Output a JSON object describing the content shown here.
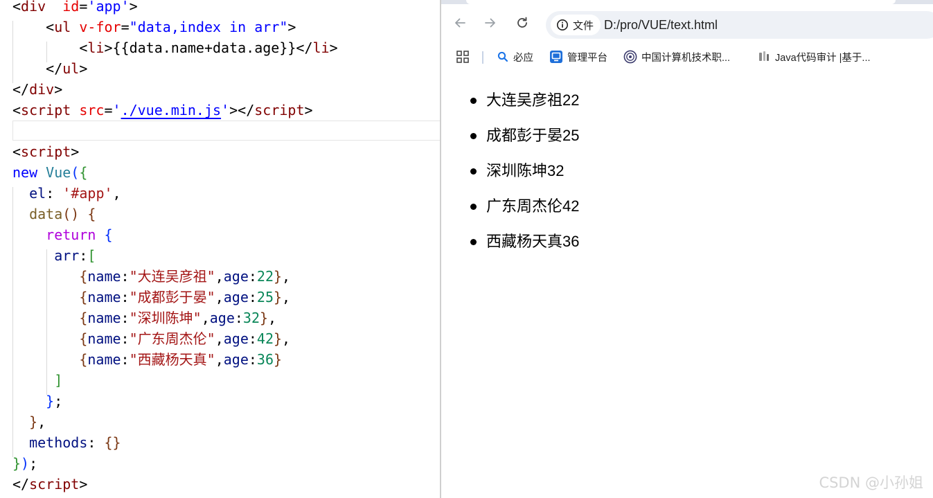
{
  "editor": {
    "lines": [
      [
        [
          "t-plain",
          "<"
        ],
        [
          "t-tag",
          "div"
        ],
        [
          "t-plain",
          "  "
        ],
        [
          "t-attr",
          "id"
        ],
        [
          "t-plain",
          "="
        ],
        [
          "t-str",
          "'app'"
        ],
        [
          "t-plain",
          ">"
        ]
      ],
      [
        [
          "t-plain",
          "    <"
        ],
        [
          "t-tag",
          "ul"
        ],
        [
          "t-plain",
          " "
        ],
        [
          "t-attr",
          "v-for"
        ],
        [
          "t-plain",
          "="
        ],
        [
          "t-str",
          "\"data,index in arr\""
        ],
        [
          "t-plain",
          ">"
        ]
      ],
      [
        [
          "t-plain",
          "        <"
        ],
        [
          "t-tag",
          "li"
        ],
        [
          "t-plain",
          ">{{data.name+data.age}}</"
        ],
        [
          "t-tag",
          "li"
        ],
        [
          "t-plain",
          ">"
        ]
      ],
      [
        [
          "t-plain",
          "    </"
        ],
        [
          "t-tag",
          "ul"
        ],
        [
          "t-plain",
          ">"
        ]
      ],
      [
        [
          "t-plain",
          "</"
        ],
        [
          "t-tag",
          "div"
        ],
        [
          "t-plain",
          ">"
        ]
      ],
      [
        [
          "t-plain",
          "<"
        ],
        [
          "t-tag",
          "script"
        ],
        [
          "t-plain",
          " "
        ],
        [
          "t-attr",
          "src"
        ],
        [
          "t-plain",
          "="
        ],
        [
          "t-str",
          "'"
        ],
        [
          "t-link",
          "./vue.min.js"
        ],
        [
          "t-str",
          "'"
        ],
        [
          "t-plain",
          "></"
        ],
        [
          "t-tag",
          "script"
        ],
        [
          "t-plain",
          ">"
        ]
      ],
      [
        [
          "t-plain",
          ""
        ]
      ],
      [
        [
          "t-plain",
          "<"
        ],
        [
          "t-tag",
          "script"
        ],
        [
          "t-plain",
          ">"
        ]
      ],
      [
        [
          "t-kw",
          "new"
        ],
        [
          "t-plain",
          " "
        ],
        [
          "t-cls",
          "Vue"
        ],
        [
          "t-b1",
          "("
        ],
        [
          "t-b2",
          "{"
        ]
      ],
      [
        [
          "t-plain",
          "  "
        ],
        [
          "t-prop",
          "el"
        ],
        [
          "t-plain",
          ": "
        ],
        [
          "t-sval",
          "'#app'"
        ],
        [
          "t-plain",
          ","
        ]
      ],
      [
        [
          "t-plain",
          "  "
        ],
        [
          "t-fn",
          "data"
        ],
        [
          "t-b3",
          "()"
        ],
        [
          "t-plain",
          " "
        ],
        [
          "t-b3",
          "{"
        ]
      ],
      [
        [
          "t-plain",
          "    "
        ],
        [
          "t-ctrl",
          "return"
        ],
        [
          "t-plain",
          " "
        ],
        [
          "t-b1",
          "{"
        ]
      ],
      [
        [
          "t-plain",
          "     "
        ],
        [
          "t-prop",
          "arr"
        ],
        [
          "t-plain",
          ":"
        ],
        [
          "t-b2",
          "["
        ]
      ],
      [
        [
          "t-plain",
          "        "
        ],
        [
          "t-b3",
          "{"
        ],
        [
          "t-prop",
          "name"
        ],
        [
          "t-plain",
          ":"
        ],
        [
          "t-sval",
          "\"大连吴彦祖\""
        ],
        [
          "t-plain",
          ","
        ],
        [
          "t-prop",
          "age"
        ],
        [
          "t-plain",
          ":"
        ],
        [
          "t-num",
          "22"
        ],
        [
          "t-b3",
          "}"
        ],
        [
          "t-plain",
          ","
        ]
      ],
      [
        [
          "t-plain",
          "        "
        ],
        [
          "t-b3",
          "{"
        ],
        [
          "t-prop",
          "name"
        ],
        [
          "t-plain",
          ":"
        ],
        [
          "t-sval",
          "\"成都彭于晏\""
        ],
        [
          "t-plain",
          ","
        ],
        [
          "t-prop",
          "age"
        ],
        [
          "t-plain",
          ":"
        ],
        [
          "t-num",
          "25"
        ],
        [
          "t-b3",
          "}"
        ],
        [
          "t-plain",
          ","
        ]
      ],
      [
        [
          "t-plain",
          "        "
        ],
        [
          "t-b3",
          "{"
        ],
        [
          "t-prop",
          "name"
        ],
        [
          "t-plain",
          ":"
        ],
        [
          "t-sval",
          "\"深圳陈坤\""
        ],
        [
          "t-plain",
          ","
        ],
        [
          "t-prop",
          "age"
        ],
        [
          "t-plain",
          ":"
        ],
        [
          "t-num",
          "32"
        ],
        [
          "t-b3",
          "}"
        ],
        [
          "t-plain",
          ","
        ]
      ],
      [
        [
          "t-plain",
          "        "
        ],
        [
          "t-b3",
          "{"
        ],
        [
          "t-prop",
          "name"
        ],
        [
          "t-plain",
          ":"
        ],
        [
          "t-sval",
          "\"广东周杰伦\""
        ],
        [
          "t-plain",
          ","
        ],
        [
          "t-prop",
          "age"
        ],
        [
          "t-plain",
          ":"
        ],
        [
          "t-num",
          "42"
        ],
        [
          "t-b3",
          "}"
        ],
        [
          "t-plain",
          ","
        ]
      ],
      [
        [
          "t-plain",
          "        "
        ],
        [
          "t-b3",
          "{"
        ],
        [
          "t-prop",
          "name"
        ],
        [
          "t-plain",
          ":"
        ],
        [
          "t-sval",
          "\"西藏杨天真\""
        ],
        [
          "t-plain",
          ","
        ],
        [
          "t-prop",
          "age"
        ],
        [
          "t-plain",
          ":"
        ],
        [
          "t-num",
          "36"
        ],
        [
          "t-b3",
          "}"
        ]
      ],
      [
        [
          "t-plain",
          "     "
        ],
        [
          "t-b2",
          "]"
        ]
      ],
      [
        [
          "t-plain",
          "    "
        ],
        [
          "t-b1",
          "}"
        ],
        [
          "t-plain",
          ";"
        ]
      ],
      [
        [
          "t-plain",
          "  "
        ],
        [
          "t-b3",
          "}"
        ],
        [
          "t-plain",
          ","
        ]
      ],
      [
        [
          "t-plain",
          "  "
        ],
        [
          "t-prop",
          "methods"
        ],
        [
          "t-plain",
          ": "
        ],
        [
          "t-b3",
          "{}"
        ]
      ],
      [
        [
          "t-b2",
          "}"
        ],
        [
          "t-b1",
          ")"
        ],
        [
          "t-plain",
          ";"
        ]
      ],
      [
        [
          "t-plain",
          "</"
        ],
        [
          "t-tag",
          "script"
        ],
        [
          "t-plain",
          ">"
        ]
      ]
    ]
  },
  "browser": {
    "nav": {
      "back_icon": "arrow-left-icon",
      "forward_icon": "arrow-right-icon",
      "reload_icon": "reload-icon"
    },
    "site_info_label": "文件",
    "url": "D:/pro/VUE/text.html",
    "bookmarks": [
      {
        "icon": "search-icon",
        "label": "必应"
      },
      {
        "icon": "management-icon",
        "label": "管理平台"
      },
      {
        "icon": "org-logo-icon",
        "label": "中国计算机技术职..."
      },
      {
        "icon": "favicon-icon",
        "label": "Java代码审计 |基于..."
      }
    ],
    "page_items": [
      "大连吴彦祖22",
      "成都彭于晏25",
      "深圳陈坤32",
      "广东周杰伦42",
      "西藏杨天真36"
    ]
  },
  "watermark": "CSDN @小孙姐",
  "colors": {
    "tag": "#800000",
    "attr": "#e50000",
    "string": "#0000ff",
    "keyword": "#0000ff",
    "control": "#af00db",
    "class": "#267f99",
    "property": "#001080",
    "function": "#795e26",
    "string_value": "#a31515",
    "number": "#098658",
    "omnibox_bg": "#eef1f6"
  }
}
